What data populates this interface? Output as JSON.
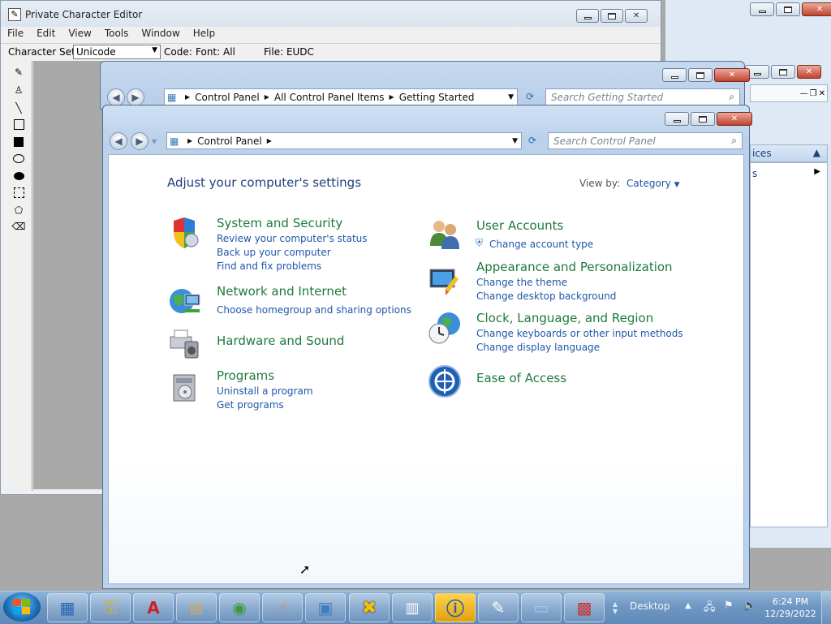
{
  "pce": {
    "title": "Private Character Editor",
    "menu": [
      "File",
      "Edit",
      "View",
      "Tools",
      "Window",
      "Help"
    ],
    "charset_label": "Character Set:",
    "charset_value": "Unicode",
    "code_label": "Code:",
    "font_label": "Font: All",
    "file_label": "File: EUDC"
  },
  "gs": {
    "breadcrumb": [
      "Control Panel",
      "All Control Panel Items",
      "Getting Started"
    ],
    "search_placeholder": "Search Getting Started"
  },
  "bg_right": {
    "partial_text_1": "ices",
    "partial_text_2": "s"
  },
  "cp": {
    "breadcrumb": [
      "Control Panel"
    ],
    "search_placeholder": "Search Control Panel",
    "heading": "Adjust your computer's settings",
    "viewby_label": "View by:",
    "viewby_value": "Category",
    "categories_left": [
      {
        "title": "System and Security",
        "links": [
          "Review your computer's status",
          "Back up your computer",
          "Find and fix problems"
        ]
      },
      {
        "title": "Network and Internet",
        "links": [
          "Choose homegroup and sharing options"
        ]
      },
      {
        "title": "Hardware and Sound",
        "links": []
      },
      {
        "title": "Programs",
        "links": [
          "Uninstall a program",
          "Get programs"
        ]
      }
    ],
    "categories_right": [
      {
        "title": "User Accounts",
        "links": [
          "Change account type"
        ]
      },
      {
        "title": "Appearance and Personalization",
        "links": [
          "Change the theme",
          "Change desktop background"
        ]
      },
      {
        "title": "Clock, Language, and Region",
        "links": [
          "Change keyboards or other input methods",
          "Change display language"
        ]
      },
      {
        "title": "Ease of Access",
        "links": []
      }
    ]
  },
  "taskbar": {
    "desktop_label": "Desktop",
    "time": "6:24 PM",
    "date": "12/29/2022"
  },
  "colors": {
    "category_green": "#1e7a3c",
    "link_blue": "#1f57a8",
    "heading_blue": "#1e3f7a"
  }
}
